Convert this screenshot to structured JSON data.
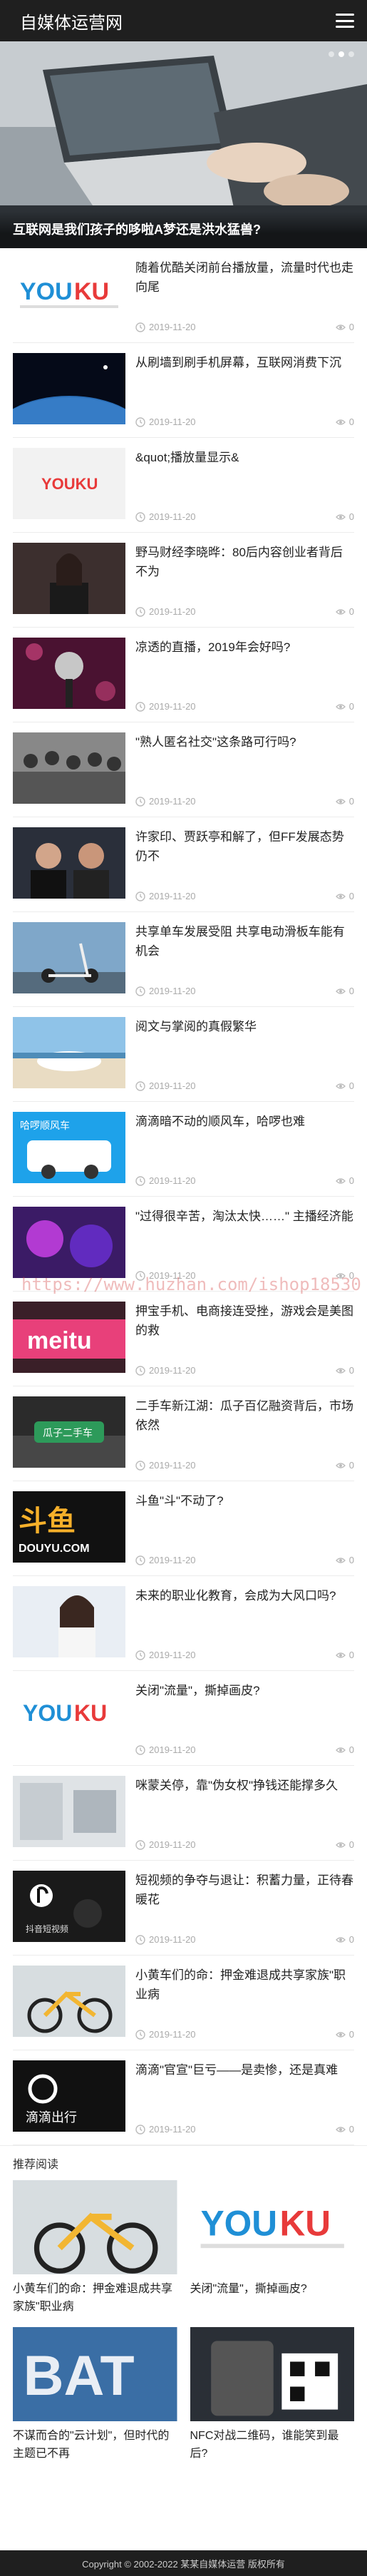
{
  "header": {
    "site_title": "自媒体运营网",
    "menu_icon": "menu-icon"
  },
  "hero": {
    "caption": "互联网是我们孩子的哆啦A梦还是洪水猛兽?",
    "slides": 3,
    "active": 1
  },
  "list": [
    {
      "title": "随着优酷关闭前台播放量，流量时代也走向尾",
      "date": "2019-11-20",
      "views": "0",
      "thumb": "youku"
    },
    {
      "title": "从刷墙到刷手机屏幕，互联网消费下沉",
      "date": "2019-11-20",
      "views": "0",
      "thumb": "earth"
    },
    {
      "title": "&quot;播放量显示&",
      "date": "2019-11-20",
      "views": "0",
      "thumb": "youku2"
    },
    {
      "title": "野马财经李晓晔：80后内容创业者背后不为",
      "date": "2019-11-20",
      "views": "0",
      "thumb": "woman"
    },
    {
      "title": "凉透的直播，2019年会好吗?",
      "date": "2019-11-20",
      "views": "0",
      "thumb": "mic"
    },
    {
      "title": "\"熟人匿名社交\"这条路可行吗?",
      "date": "2019-11-20",
      "views": "0",
      "thumb": "people"
    },
    {
      "title": "许家印、贾跃亭和解了，但FF发展态势仍不",
      "date": "2019-11-20",
      "views": "0",
      "thumb": "men"
    },
    {
      "title": "共享单车发展受阻 共享电动滑板车能有机会",
      "date": "2019-11-20",
      "views": "0",
      "thumb": "scooter"
    },
    {
      "title": "阅文与掌阅的真假繁华",
      "date": "2019-11-20",
      "views": "0",
      "thumb": "beach"
    },
    {
      "title": "滴滴暗不动的顺风车，哈啰也难",
      "date": "2019-11-20",
      "views": "0",
      "thumb": "hello"
    },
    {
      "title": "\"过得很辛苦，淘汰太快……\" 主播经济能",
      "date": "2019-11-20",
      "views": "0",
      "thumb": "purple"
    },
    {
      "title": "押宝手机、电商接连受挫，游戏会是美图的救",
      "date": "2019-11-20",
      "views": "0",
      "thumb": "meitu"
    },
    {
      "title": "二手车新江湖：瓜子百亿融资背后，市场依然",
      "date": "2019-11-20",
      "views": "0",
      "thumb": "car"
    },
    {
      "title": "斗鱼\"斗\"不动了?",
      "date": "2019-11-20",
      "views": "0",
      "thumb": "douyu"
    },
    {
      "title": "未来的职业化教育，会成为大风口吗?",
      "date": "2019-11-20",
      "views": "0",
      "thumb": "girl"
    },
    {
      "title": "关闭\"流量\"，撕掉画皮?",
      "date": "2019-11-20",
      "views": "0",
      "thumb": "youku3"
    },
    {
      "title": "咪蒙关停，靠\"伪女权\"挣钱还能撑多久",
      "date": "2019-11-20",
      "views": "0",
      "thumb": "office"
    },
    {
      "title": "短视频的争夺与退让：积蓄力量，正待春暖花",
      "date": "2019-11-20",
      "views": "0",
      "thumb": "tiktok"
    },
    {
      "title": "小黄车们的命：押金难退成共享家族\"职业病",
      "date": "2019-11-20",
      "views": "0",
      "thumb": "bike"
    },
    {
      "title": "滴滴\"官宣\"巨亏——是卖惨，还是真难",
      "date": "2019-11-20",
      "views": "0",
      "thumb": "didi"
    }
  ],
  "recommend": {
    "heading": "推荐阅读",
    "items": [
      {
        "title": "小黄车们的命：押金难退成共享家族\"职业病",
        "thumb": "bike"
      },
      {
        "title": "关闭\"流量\"，撕掉画皮?",
        "thumb": "youku"
      },
      {
        "title": "不谋而合的\"云计划\"，但时代的主题已不再",
        "thumb": "bat"
      },
      {
        "title": "NFC对战二维码，谁能笑到最后?",
        "thumb": "nfc"
      }
    ]
  },
  "footer": {
    "text": "Copyright © 2002-2022 某某自媒体运营 版权所有"
  },
  "watermark": {
    "text": "https://www.huzhan.com/ishop18530"
  }
}
